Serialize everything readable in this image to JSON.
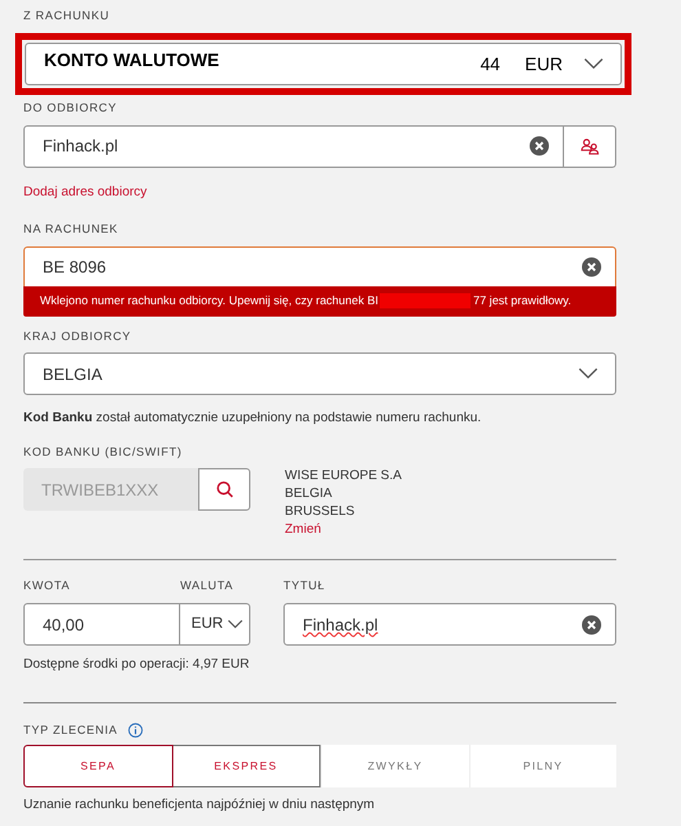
{
  "from_account": {
    "label": "Z RACHUNKU",
    "name": "KONTO WALUTOWE",
    "amount": "44",
    "currency": "EUR",
    "highlighted": true
  },
  "recipient": {
    "label": "DO ODBIORCY",
    "value": "Finhack.pl",
    "add_address_link": "Dodaj adres odbiorcy"
  },
  "account_number": {
    "label": "NA RACHUNEK",
    "value": "BE 8096",
    "error": true,
    "error_text_start": "Wklejono numer rachunku odbiorcy. Upewnij się, czy rachunek BI",
    "error_text_end": "77 jest prawidłowy."
  },
  "country": {
    "label": "KRAJ ODBIORCY",
    "value": "BELGIA"
  },
  "bank_code_note": "**Kod Banku** został automatycznie uzupełniony na podstawie numeru rachunku.",
  "bank_code": {
    "label": "KOD BANKU (BIC/SWIFT)",
    "value": "TRWIBEB1XXX",
    "disabled": true,
    "bank_lines": [
      "WISE EUROPE S.A",
      "BELGIA",
      "BRUSSELS"
    ],
    "change_link": "Zmień"
  },
  "amount": {
    "label": "KWOTA",
    "value": "40,00"
  },
  "currency": {
    "label": "WALUTA",
    "value": "EUR"
  },
  "title": {
    "label": "TYTUŁ",
    "value": "Finhack.pl"
  },
  "available_funds": "Dostępne środki po operacji: 4,97 EUR",
  "order_type": {
    "label": "TYP ZLECENIA",
    "options": [
      {
        "label": "SEPA",
        "selected": true,
        "disabled": false
      },
      {
        "label": "EKSPRES",
        "selected": false,
        "disabled": false
      },
      {
        "label": "ZWYKŁY",
        "selected": false,
        "disabled": true
      },
      {
        "label": "PILNY",
        "selected": false,
        "disabled": true
      }
    ],
    "note": "Uznanie rachunku beneficjenta najpóźniej w dniu następnym"
  }
}
